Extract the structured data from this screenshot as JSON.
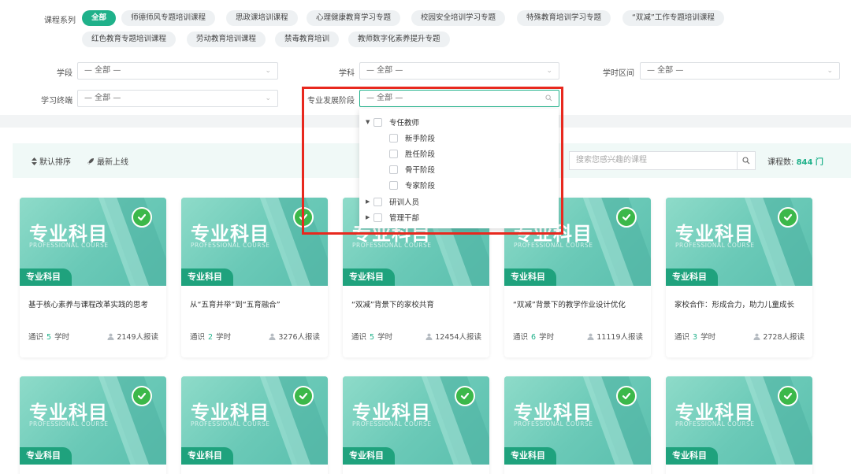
{
  "series": {
    "label": "课程系列",
    "chips": [
      {
        "label": "全部",
        "active": true
      },
      {
        "label": "师德师风专题培训课程"
      },
      {
        "label": "思政课培训课程"
      },
      {
        "label": "心理健康教育学习专题"
      },
      {
        "label": "校园安全培训学习专题"
      },
      {
        "label": "特殊教育培训学习专题"
      },
      {
        "label": "“双减”工作专题培训课程"
      },
      {
        "label": "红色教育专题培训课程"
      },
      {
        "label": "劳动教育培训课程"
      },
      {
        "label": "禁毒教育培训"
      },
      {
        "label": "教师数字化素养提升专题"
      }
    ]
  },
  "filters": {
    "stage": {
      "label": "学段",
      "value": "— 全部 —"
    },
    "subject": {
      "label": "学科",
      "value": "— 全部 —"
    },
    "hours": {
      "label": "学时区间",
      "value": "— 全部 —"
    },
    "terminal": {
      "label": "学习终端",
      "value": "— 全部 —"
    },
    "dev_stage": {
      "label": "专业发展阶段",
      "value": "— 全部 —"
    }
  },
  "dropdown": {
    "tree": [
      {
        "label": "专任教师",
        "expanded": true,
        "children": [
          "新手阶段",
          "胜任阶段",
          "骨干阶段",
          "专家阶段"
        ]
      },
      {
        "label": "研训人员",
        "expanded": false
      },
      {
        "label": "管理干部",
        "expanded": false
      }
    ]
  },
  "toolbar": {
    "sort_default": "默认排序",
    "sort_new": "最新上线",
    "search_placeholder": "搜索您感兴趣的课程",
    "count_label": "课程数:",
    "count_value": "844 门"
  },
  "card_cover": {
    "title": "专业科目",
    "subtitle": "PROFESSIONAL COURSE",
    "badge": "专业科目"
  },
  "cards": [
    {
      "title": "基于核心素养与课程改革实践的思考",
      "category": "通识",
      "hours": "5",
      "hours_unit": "学时",
      "enrolled": "2149人报读"
    },
    {
      "title": "从“五育并举”到“五育融合”",
      "category": "通识",
      "hours": "2",
      "hours_unit": "学时",
      "enrolled": "3276人报读"
    },
    {
      "title": "“双减”背景下的家校共育",
      "category": "通识",
      "hours": "5",
      "hours_unit": "学时",
      "enrolled": "12454人报读"
    },
    {
      "title": "“双减”背景下的教学作业设计优化",
      "category": "通识",
      "hours": "6",
      "hours_unit": "学时",
      "enrolled": "11119人报读"
    },
    {
      "title": "家校合作：形成合力，助力儿童成长",
      "category": "通识",
      "hours": "3",
      "hours_unit": "学时",
      "enrolled": "2728人报读"
    }
  ],
  "colors": {
    "accent": "#1fb18a",
    "highlight": "#e8281e"
  }
}
